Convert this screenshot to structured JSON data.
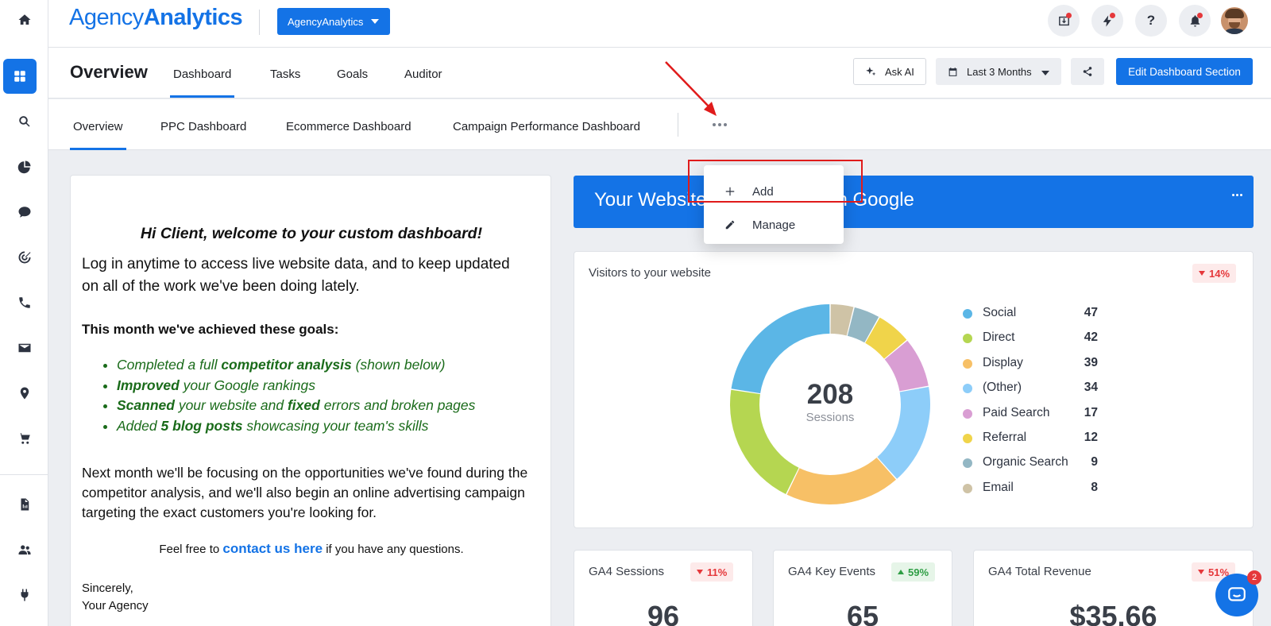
{
  "brand": {
    "logo_light": "Agency",
    "logo_bold": "Analytics"
  },
  "account_button": "AgencyAnalytics",
  "page": {
    "title": "Overview",
    "tabs": [
      "Dashboard",
      "Tasks",
      "Goals",
      "Auditor"
    ],
    "active_tab": "Dashboard"
  },
  "header_buttons": {
    "ask_ai": "Ask AI",
    "date_range": "Last 3 Months",
    "edit": "Edit Dashboard Section"
  },
  "subtabs": [
    "Overview",
    "PPC Dashboard",
    "Ecommerce Dashboard",
    "Campaign Performance Dashboard"
  ],
  "active_subtab": "Overview",
  "dropdown_menu": {
    "add": "Add",
    "manage": "Manage"
  },
  "welcome": {
    "heading": "Hi Client, welcome to your custom dashboard!",
    "intro": "Log in anytime to access live website data, and to keep updated on all of the work we've been doing lately.",
    "goals_title": "This month we've achieved these goals:",
    "goals": [
      {
        "a": "Completed a full ",
        "b": "competitor analysis",
        "c": " (shown below)",
        "d": "",
        "e": ""
      },
      {
        "a": "",
        "b": "Improved",
        "c": " your Google rankings",
        "d": "",
        "e": ""
      },
      {
        "a": "",
        "b": "Scanned",
        "c": " your website and ",
        "d": "fixed",
        "e": " errors and broken pages"
      },
      {
        "a": "Added ",
        "b": "5 blog posts",
        "c": " showcasing your team's skills",
        "d": "",
        "e": ""
      }
    ],
    "next": "Next month we'll be focusing on the opportunities we've found during the competitor analysis, and we'll also begin an online advertising campaign targeting the exact customers you're looking for.",
    "contact_prefix": "Feel free to ",
    "contact_link": "contact us here",
    "contact_suffix": " if you have any questions.",
    "sign_line1": "Sincerely,",
    "sign_line2": "Your Agency"
  },
  "banner": {
    "title": "Your Website Performance on Google"
  },
  "visitors": {
    "label": "Visitors to your website",
    "change": "14%",
    "total": "208",
    "total_label": "Sessions"
  },
  "chart_data": {
    "type": "pie",
    "categories": [
      "Social",
      "Direct",
      "Display",
      "(Other)",
      "Paid Search",
      "Referral",
      "Organic Search",
      "Email"
    ],
    "values": [
      47,
      42,
      39,
      34,
      17,
      12,
      9,
      8
    ],
    "colors": [
      "#5bb6e6",
      "#b5d651",
      "#f7c066",
      "#8dcdf9",
      "#d99ed3",
      "#f0d44a",
      "#93b7c4",
      "#cfc3a6"
    ],
    "center_label": "208",
    "center_sublabel": "Sessions"
  },
  "metrics": [
    {
      "name": "GA4 Sessions",
      "change": "11%",
      "direction": "down",
      "value": "96"
    },
    {
      "name": "GA4 Key Events",
      "change": "59%",
      "direction": "up",
      "value": "65"
    },
    {
      "name": "GA4 Total Revenue",
      "change": "51%",
      "direction": "down",
      "value": "$35.66"
    }
  ],
  "chat": {
    "count": "2"
  },
  "icons": {
    "rail": [
      "home-icon",
      "dashboard-grid-icon",
      "search-icon",
      "pie-chart-icon",
      "chat-icon",
      "target-icon",
      "phone-icon",
      "mail-icon",
      "location-pin-icon",
      "cart-icon",
      "report-icon",
      "users-icon",
      "plug-icon"
    ],
    "topbar": [
      "download-icon",
      "lightning-icon",
      "help-icon",
      "bell-icon"
    ]
  }
}
